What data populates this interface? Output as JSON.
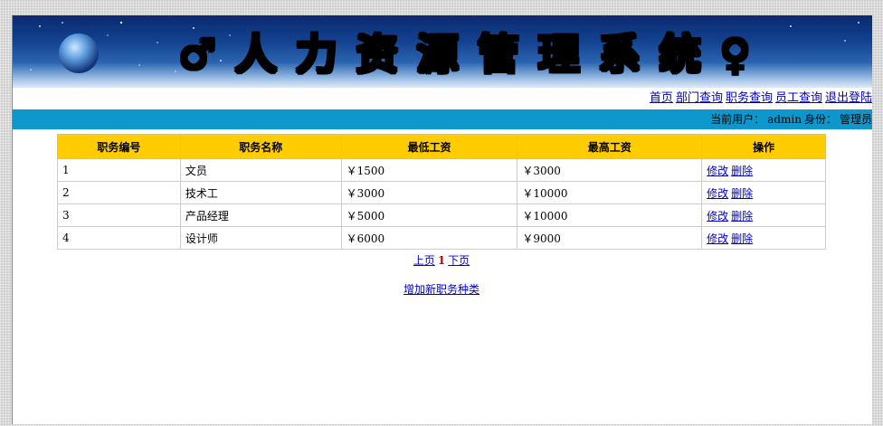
{
  "banner": {
    "title": "♂人力资源管理系统♀"
  },
  "nav": {
    "links": [
      "首页",
      "部门查询",
      "职务查询",
      "员工查询",
      "退出登陆"
    ]
  },
  "status": {
    "user_label": "当前用户：",
    "user_name": "admin",
    "role_label": "身份：",
    "role_value": "管理员"
  },
  "table": {
    "headers": [
      "职务编号",
      "职务名称",
      "最低工资",
      "最高工资",
      "操作"
    ],
    "rows": [
      {
        "id": "1",
        "name": "文员",
        "min": "￥1500",
        "max": "￥3000",
        "edit": "修改",
        "delete": "删除"
      },
      {
        "id": "2",
        "name": "技术工",
        "min": "￥3000",
        "max": "￥10000",
        "edit": "修改",
        "delete": "删除"
      },
      {
        "id": "3",
        "name": "产品经理",
        "min": "￥5000",
        "max": "￥10000",
        "edit": "修改",
        "delete": "删除"
      },
      {
        "id": "4",
        "name": "设计师",
        "min": "￥6000",
        "max": "￥9000",
        "edit": "修改",
        "delete": "删除"
      }
    ]
  },
  "pager": {
    "prev": "上页",
    "current": "1",
    "next": "下页"
  },
  "actions": {
    "add_label": "增加新职务种类"
  },
  "colors": {
    "header_bg": "#ffcc00",
    "status_bar": "#0e97cc",
    "link": "#0000cc",
    "current_page": "#cc0000"
  }
}
